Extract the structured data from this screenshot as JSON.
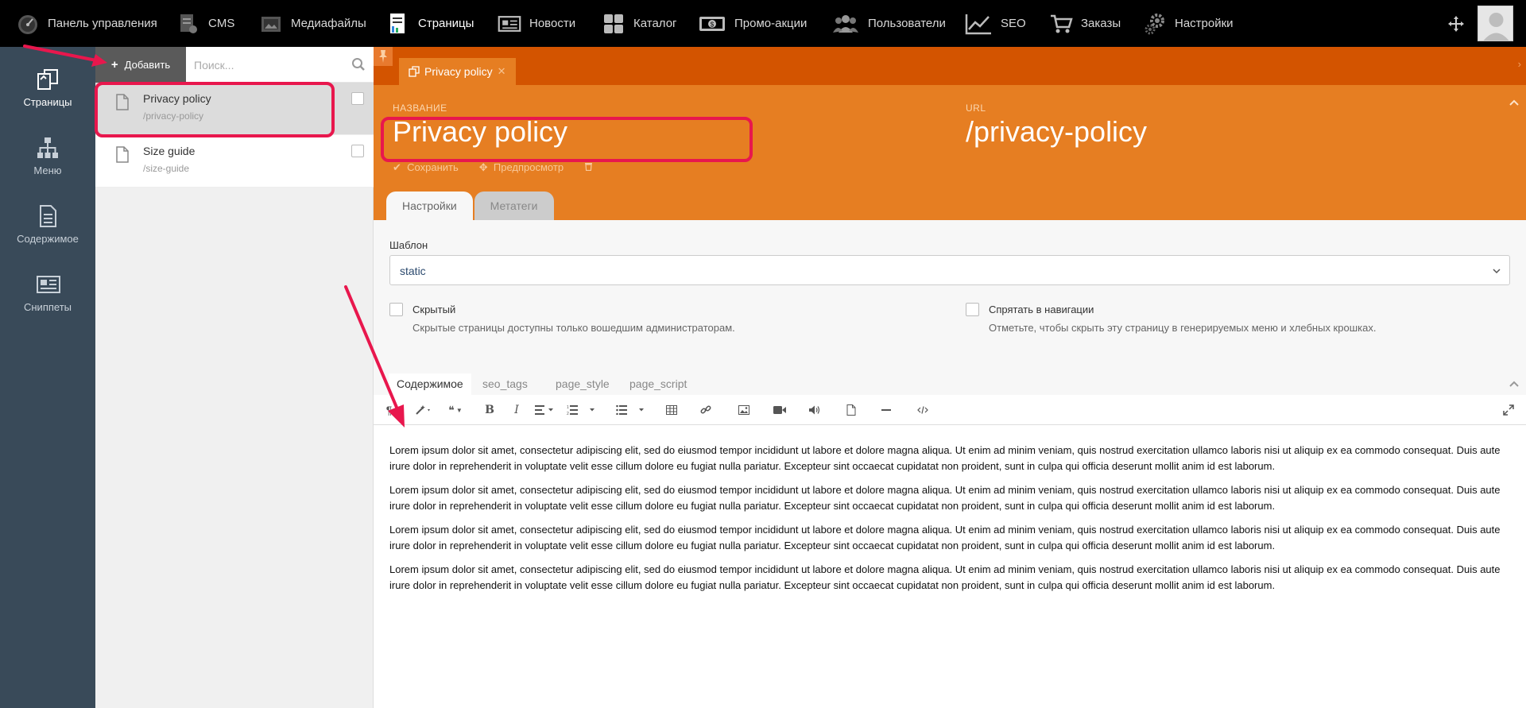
{
  "topnav": {
    "items": [
      {
        "label": "Панель управления",
        "icon": "dashboard-icon"
      },
      {
        "label": "CMS",
        "icon": "cms-icon"
      },
      {
        "label": "Медиафайлы",
        "icon": "media-icon"
      },
      {
        "label": "Страницы",
        "icon": "pages-icon",
        "active": true
      },
      {
        "label": "Новости",
        "icon": "news-icon"
      },
      {
        "label": "Каталог",
        "icon": "catalog-icon"
      },
      {
        "label": "Промо-акции",
        "icon": "promo-icon"
      },
      {
        "label": "Пользователи",
        "icon": "users-icon"
      },
      {
        "label": "SEO",
        "icon": "seo-icon"
      },
      {
        "label": "Заказы",
        "icon": "cart-icon"
      },
      {
        "label": "Настройки",
        "icon": "settings-icon"
      }
    ]
  },
  "leftbar": {
    "items": [
      {
        "label": "Страницы",
        "icon": "pages-icon",
        "active": true
      },
      {
        "label": "Меню",
        "icon": "sitemap-icon"
      },
      {
        "label": "Содержимое",
        "icon": "document-icon"
      },
      {
        "label": "Сниппеты",
        "icon": "snippets-icon"
      }
    ]
  },
  "list": {
    "add_label": "Добавить",
    "search_placeholder": "Поиск...",
    "pages": [
      {
        "title": "Privacy policy",
        "slug": "/privacy-policy",
        "selected": true
      },
      {
        "title": "Size guide",
        "slug": "/size-guide",
        "selected": false
      }
    ]
  },
  "editor": {
    "open_tab": "Privacy policy",
    "name_label": "НАЗВАНИЕ",
    "name_value": "Privacy policy",
    "url_label": "URL",
    "url_value": "/privacy-policy",
    "save_label": "Сохранить",
    "preview_label": "Предпросмотр",
    "subtabs": [
      "Настройки",
      "Метатеги"
    ],
    "template_label": "Шаблон",
    "template_value": "static",
    "hidden_label": "Скрытый",
    "hidden_help": "Скрытые страницы доступны только вошедшим администраторам.",
    "hide_nav_label": "Спрятать в навигации",
    "hide_nav_help": "Отметьте, чтобы скрыть эту страницу в генерируемых меню и хлебных крошках.",
    "content_tabs": [
      "Содержимое",
      "seo_tags",
      "page_style",
      "page_script"
    ],
    "paragraphs": [
      "Lorem ipsum dolor sit amet, consectetur adipiscing elit, sed do eiusmod tempor incididunt ut labore et dolore magna aliqua. Ut enim ad minim veniam, quis nostrud exercitation ullamco laboris nisi ut aliquip ex ea commodo consequat. Duis aute irure dolor in reprehenderit in voluptate velit esse cillum dolore eu fugiat nulla pariatur. Excepteur sint occaecat cupidatat non proident, sunt in culpa qui officia deserunt mollit anim id est laborum.",
      "Lorem ipsum dolor sit amet, consectetur adipiscing elit, sed do eiusmod tempor incididunt ut labore et dolore magna aliqua. Ut enim ad minim veniam, quis nostrud exercitation ullamco laboris nisi ut aliquip ex ea commodo consequat. Duis aute irure dolor in reprehenderit in voluptate velit esse cillum dolore eu fugiat nulla pariatur. Excepteur sint occaecat cupidatat non proident, sunt in culpa qui officia deserunt mollit anim id est laborum.",
      "Lorem ipsum dolor sit amet, consectetur adipiscing elit, sed do eiusmod tempor incididunt ut labore et dolore magna aliqua. Ut enim ad minim veniam, quis nostrud exercitation ullamco laboris nisi ut aliquip ex ea commodo consequat. Duis aute irure dolor in reprehenderit in voluptate velit esse cillum dolore eu fugiat nulla pariatur. Excepteur sint occaecat cupidatat non proident, sunt in culpa qui officia deserunt mollit anim id est laborum.",
      "Lorem ipsum dolor sit amet, consectetur adipiscing elit, sed do eiusmod tempor incididunt ut labore et dolore magna aliqua. Ut enim ad minim veniam, quis nostrud exercitation ullamco laboris nisi ut aliquip ex ea commodo consequat. Duis aute irure dolor in reprehenderit in voluptate velit esse cillum dolore eu fugiat nulla pariatur. Excepteur sint occaecat cupidatat non proident, sunt in culpa qui officia deserunt mollit anim id est laborum."
    ]
  },
  "colors": {
    "header_orange": "#e67e22",
    "tabbar_orange": "#d35400",
    "sidebar": "#394a59",
    "annotation": "#e8174d"
  }
}
